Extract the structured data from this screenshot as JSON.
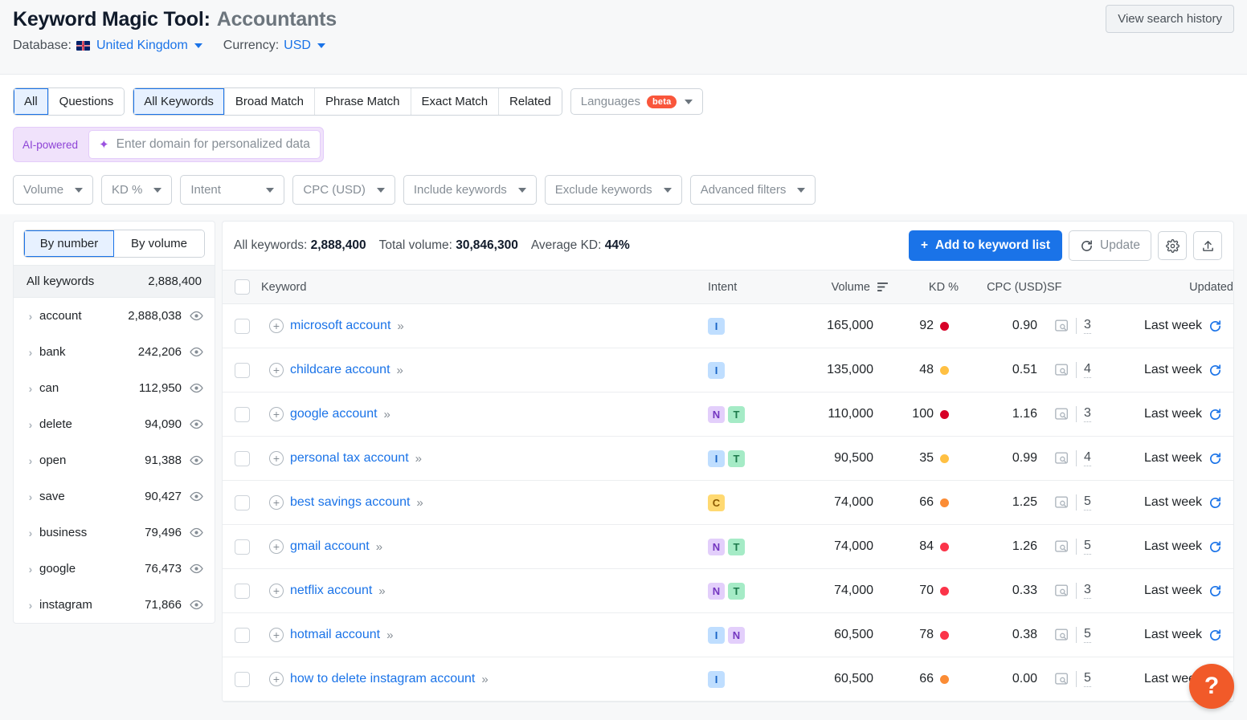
{
  "header": {
    "title_main": "Keyword Magic Tool:",
    "title_sub": "Accountants",
    "database_label": "Database:",
    "database_value": "United Kingdom",
    "currency_label": "Currency:",
    "currency_value": "USD",
    "search_history_button": "View search history"
  },
  "filters": {
    "question_tabs": [
      {
        "label": "All",
        "active": true
      },
      {
        "label": "Questions",
        "active": false
      }
    ],
    "match_tabs": [
      {
        "label": "All Keywords",
        "active": true
      },
      {
        "label": "Broad Match",
        "active": false
      },
      {
        "label": "Phrase Match",
        "active": false
      },
      {
        "label": "Exact Match",
        "active": false
      },
      {
        "label": "Related",
        "active": false
      }
    ],
    "languages_label": "Languages",
    "languages_badge": "beta",
    "ai_label": "AI-powered",
    "ai_placeholder": "Enter domain for personalized data",
    "dropdowns": [
      {
        "label": "Volume"
      },
      {
        "label": "KD %"
      },
      {
        "label": "Intent"
      },
      {
        "label": "CPC (USD)"
      },
      {
        "label": "Include keywords"
      },
      {
        "label": "Exclude keywords"
      },
      {
        "label": "Advanced filters"
      }
    ]
  },
  "sidebar": {
    "toggle": [
      {
        "label": "By number",
        "active": true
      },
      {
        "label": "By volume",
        "active": false
      }
    ],
    "all_keywords_label": "All keywords",
    "all_keywords_count": "2,888,400",
    "items": [
      {
        "label": "account",
        "count": "2,888,038"
      },
      {
        "label": "bank",
        "count": "242,206"
      },
      {
        "label": "can",
        "count": "112,950"
      },
      {
        "label": "delete",
        "count": "94,090"
      },
      {
        "label": "open",
        "count": "91,388"
      },
      {
        "label": "save",
        "count": "90,427"
      },
      {
        "label": "business",
        "count": "79,496"
      },
      {
        "label": "google",
        "count": "76,473"
      },
      {
        "label": "instagram",
        "count": "71,866"
      }
    ]
  },
  "table": {
    "stats": {
      "all_keywords_label": "All keywords:",
      "all_keywords_value": "2,888,400",
      "total_volume_label": "Total volume:",
      "total_volume_value": "30,846,300",
      "average_kd_label": "Average KD:",
      "average_kd_value": "44%"
    },
    "actions": {
      "add_to_list": "Add to keyword list",
      "update": "Update",
      "settings": "settings",
      "export": "export"
    },
    "columns": {
      "keyword": "Keyword",
      "intent": "Intent",
      "volume": "Volume",
      "kd": "KD %",
      "cpc": "CPC (USD)",
      "sf": "SF",
      "updated": "Updated"
    },
    "rows": [
      {
        "keyword": "microsoft account",
        "intent": [
          "I"
        ],
        "volume": "165,000",
        "kd": "92",
        "kd_color": "#d70027",
        "cpc": "0.90",
        "sf": "3",
        "updated": "Last week"
      },
      {
        "keyword": "childcare account",
        "intent": [
          "I"
        ],
        "volume": "135,000",
        "kd": "48",
        "kd_color": "#ffc043",
        "cpc": "0.51",
        "sf": "4",
        "updated": "Last week"
      },
      {
        "keyword": "google account",
        "intent": [
          "N",
          "T"
        ],
        "volume": "110,000",
        "kd": "100",
        "kd_color": "#d70027",
        "cpc": "1.16",
        "sf": "3",
        "updated": "Last week"
      },
      {
        "keyword": "personal tax account",
        "intent": [
          "I",
          "T"
        ],
        "volume": "90,500",
        "kd": "35",
        "kd_color": "#ffc043",
        "cpc": "0.99",
        "sf": "4",
        "updated": "Last week"
      },
      {
        "keyword": "best savings account",
        "intent": [
          "C"
        ],
        "volume": "74,000",
        "kd": "66",
        "kd_color": "#fb8c35",
        "cpc": "1.25",
        "sf": "5",
        "updated": "Last week"
      },
      {
        "keyword": "gmail account",
        "intent": [
          "N",
          "T"
        ],
        "volume": "74,000",
        "kd": "84",
        "kd_color": "#fb3449",
        "cpc": "1.26",
        "sf": "5",
        "updated": "Last week"
      },
      {
        "keyword": "netflix account",
        "intent": [
          "N",
          "T"
        ],
        "volume": "74,000",
        "kd": "70",
        "kd_color": "#fb3449",
        "cpc": "0.33",
        "sf": "3",
        "updated": "Last week"
      },
      {
        "keyword": "hotmail account",
        "intent": [
          "I",
          "N"
        ],
        "volume": "60,500",
        "kd": "78",
        "kd_color": "#fb3449",
        "cpc": "0.38",
        "sf": "5",
        "updated": "Last week"
      },
      {
        "keyword": "how to delete instagram account",
        "intent": [
          "I"
        ],
        "volume": "60,500",
        "kd": "66",
        "kd_color": "#fb8c35",
        "cpc": "0.00",
        "sf": "5",
        "updated": "Last week"
      }
    ]
  },
  "help": {
    "label": "?"
  },
  "colors": {
    "accent": "#1a73e8",
    "beta": "#f9563b",
    "ai": "#8d43d6",
    "help": "#f15a29"
  }
}
